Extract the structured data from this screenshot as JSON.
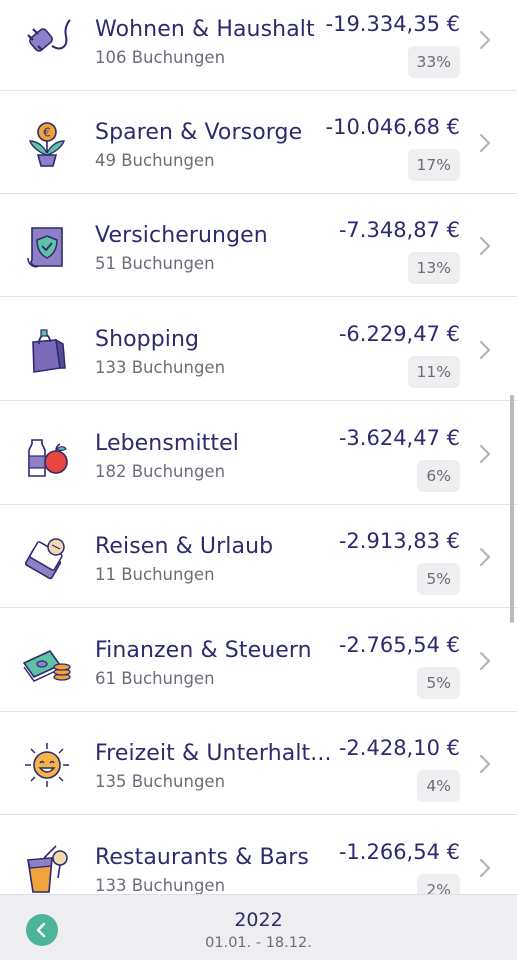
{
  "categories": [
    {
      "name": "Wohnen & Haushalt",
      "count": "106 Buchungen",
      "amount": "-19.334,35 €",
      "percent": "33%",
      "icon": "plug-icon"
    },
    {
      "name": "Sparen & Vorsorge",
      "count": "49 Buchungen",
      "amount": "-10.046,68 €",
      "percent": "17%",
      "icon": "euro-plant-icon"
    },
    {
      "name": "Versicherungen",
      "count": "51 Buchungen",
      "amount": "-7.348,87 €",
      "percent": "13%",
      "icon": "insurance-shield-icon"
    },
    {
      "name": "Shopping",
      "count": "133 Buchungen",
      "amount": "-6.229,47 €",
      "percent": "11%",
      "icon": "shopping-bag-icon"
    },
    {
      "name": "Lebensmittel",
      "count": "182 Buchungen",
      "amount": "-3.624,47 €",
      "percent": "6%",
      "icon": "groceries-icon"
    },
    {
      "name": "Reisen & Urlaub",
      "count": "11 Buchungen",
      "amount": "-2.913,83 €",
      "percent": "5%",
      "icon": "travel-ticket-icon"
    },
    {
      "name": "Finanzen & Steuern",
      "count": "61 Buchungen",
      "amount": "-2.765,54 €",
      "percent": "5%",
      "icon": "money-coins-icon"
    },
    {
      "name": "Freizeit & Unterhalt...",
      "count": "135 Buchungen",
      "amount": "-2.428,10 €",
      "percent": "4%",
      "icon": "sun-face-icon"
    },
    {
      "name": "Restaurants & Bars",
      "count": "133 Buchungen",
      "amount": "-1.266,54 €",
      "percent": "2%",
      "icon": "drink-food-icon"
    }
  ],
  "footer": {
    "year": "2022",
    "range": "01.01. - 18.12.",
    "back_icon": "chevron-left-icon"
  },
  "colors": {
    "text_primary": "#2d2a6e",
    "text_secondary": "#6d6d7a",
    "accent": "#4db39b",
    "icon_purple": "#7b6bb8"
  }
}
